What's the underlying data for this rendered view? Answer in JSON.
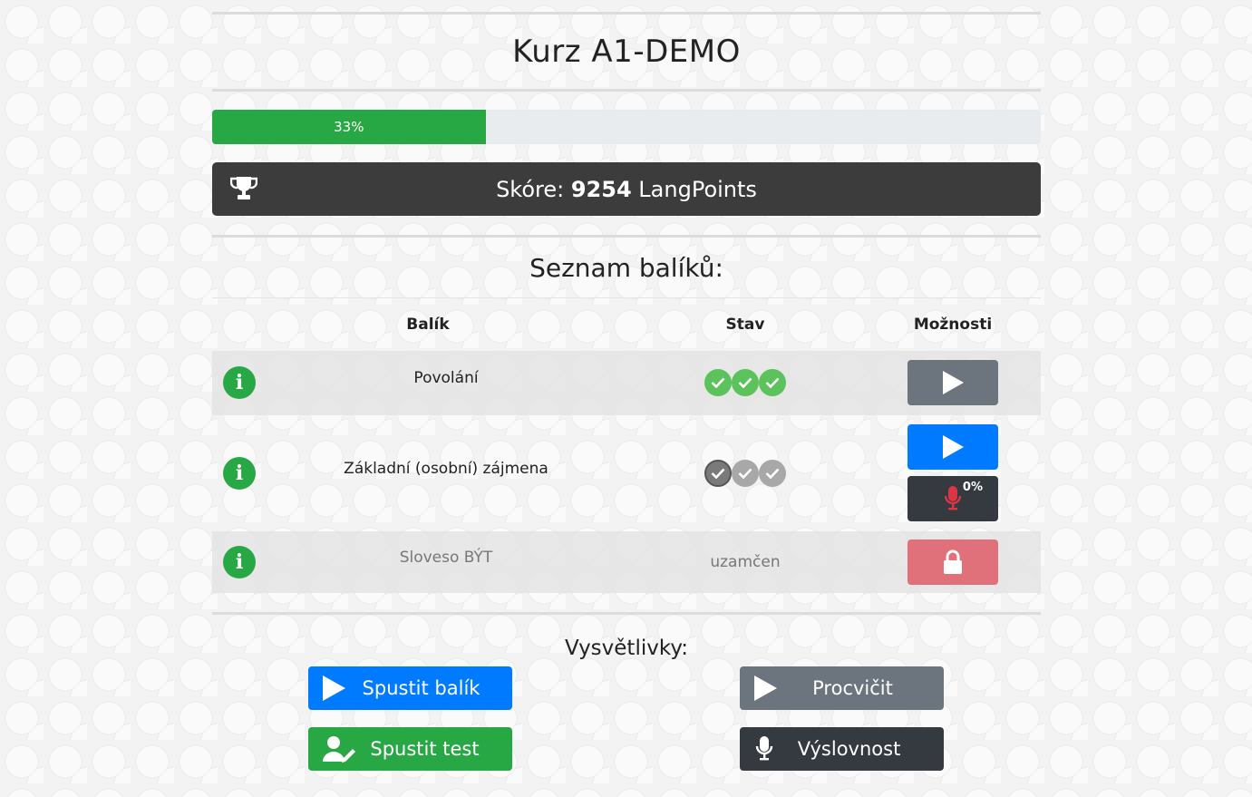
{
  "course": {
    "title": "Kurz A1-DEMO"
  },
  "progress": {
    "percent": 33,
    "label": "33%"
  },
  "score": {
    "prefix": "Skóre:",
    "value": "9254",
    "unit": "LangPoints",
    "icon": "trophy-icon"
  },
  "packages": {
    "title": "Seznam balíků:",
    "columns": [
      "Balík",
      "Stav",
      "Možnosti"
    ],
    "rows": [
      {
        "name": "Povolání",
        "status": "completed",
        "checks": [
          "green",
          "green",
          "green"
        ],
        "actions": [
          "play-gray"
        ]
      },
      {
        "name": "Základní (osobní) zájmena",
        "status": "in-progress",
        "checks": [
          "gray",
          "gray",
          "gray"
        ],
        "actions": [
          "play-blue",
          "pronunciation"
        ],
        "pronunciation_label": "0%"
      },
      {
        "name": "Sloveso BÝT",
        "status_text": "uzamčen",
        "actions": [
          "locked"
        ]
      }
    ]
  },
  "legend": {
    "title": "Vysvětlivky:",
    "start_package": "Spustit balík",
    "practice": "Procvičit",
    "start_test": "Spustit test",
    "pronunciation": "Výslovnost"
  },
  "colors": {
    "green": "#28a745",
    "blue": "#007bff",
    "gray": "#6c757d",
    "dark": "#343a40",
    "red": "#e0707a"
  }
}
